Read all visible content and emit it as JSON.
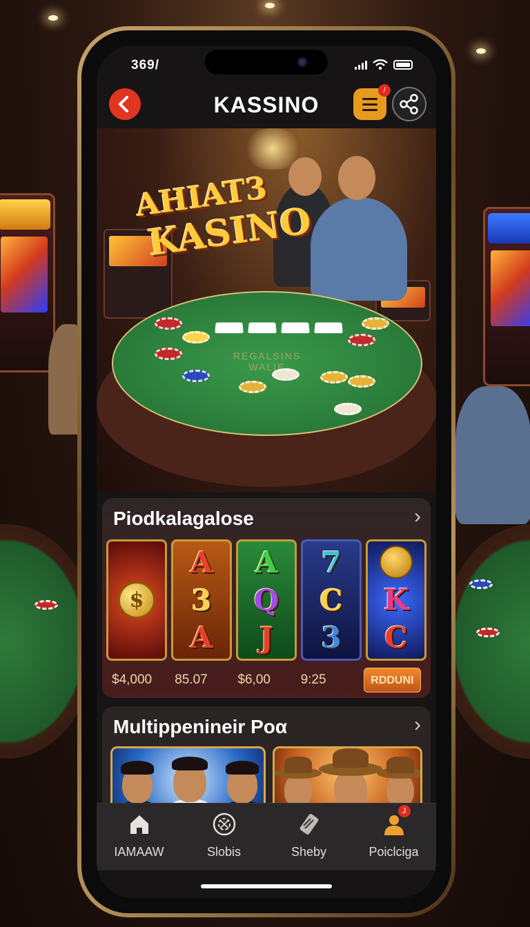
{
  "status_bar": {
    "time": "369/"
  },
  "header": {
    "title": "KASSINO",
    "back_icon": "chevron-left-icon",
    "menu_icon": "list-icon",
    "menu_badge": "/",
    "share_icon": "share-icon"
  },
  "hero": {
    "logo_line1": "AHIAT3",
    "logo_line2": "KASINO",
    "felt_text_1": "REGALSINS",
    "felt_text_2": "WALIE"
  },
  "slots_section": {
    "title": "Piodkalagalose",
    "games": [
      {
        "glyphs": [
          "coin"
        ],
        "bg": "#8a1a14"
      },
      {
        "glyphs": [
          "A",
          "3",
          "A"
        ],
        "bg": "#7a2a0e"
      },
      {
        "glyphs": [
          "A",
          "Q",
          "J"
        ],
        "bg": "#1e6a2a"
      },
      {
        "glyphs": [
          "7",
          "C",
          "3"
        ],
        "bg": "#1e2a6a"
      },
      {
        "glyphs": [
          "face",
          "K",
          "C"
        ],
        "bg": "#1a2a8a"
      }
    ],
    "prices": [
      "$4,000",
      "85.07",
      "$6,00",
      "9:25"
    ],
    "cta_label": "RDDUNI"
  },
  "multiplayer_section": {
    "title": "Multippenineir Poα"
  },
  "bottom_nav": {
    "items": [
      {
        "label": "IAMAAW",
        "icon": "home-icon"
      },
      {
        "label": "Slobis",
        "icon": "chip-icon"
      },
      {
        "label": "Sheby",
        "icon": "card-icon"
      },
      {
        "label": "Poiclciga",
        "icon": "user-icon",
        "badge": "J"
      }
    ]
  },
  "colors": {
    "accent": "#e79a1e",
    "back_button": "#e0351f",
    "badge": "#e02a1e",
    "card_border": "#c89a3a"
  }
}
